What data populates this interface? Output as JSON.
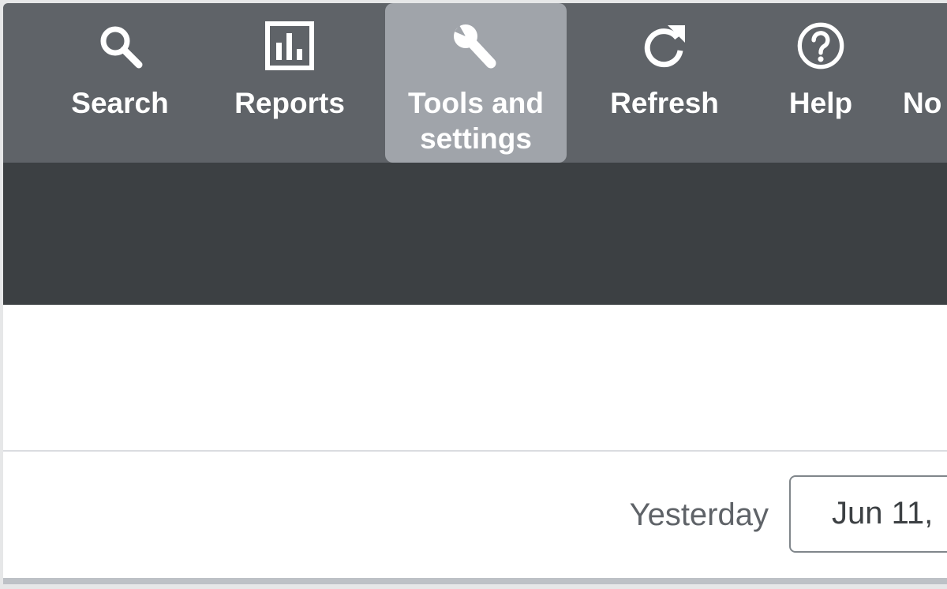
{
  "nav": {
    "items": [
      {
        "label": "Search",
        "icon": "search-icon"
      },
      {
        "label": "Reports",
        "icon": "bar-chart-icon"
      },
      {
        "label": "Tools and\nsettings",
        "icon": "wrench-icon",
        "active": true
      },
      {
        "label": "Refresh",
        "icon": "refresh-icon"
      },
      {
        "label": "Help",
        "icon": "help-icon"
      },
      {
        "label": "No",
        "icon": ""
      }
    ]
  },
  "date_filter": {
    "preset_label": "Yesterday",
    "value": "Jun 11,"
  },
  "colors": {
    "nav_bg": "#5f6368",
    "nav_active_bg": "#a0a4aa",
    "dark_band": "#3c4043"
  }
}
